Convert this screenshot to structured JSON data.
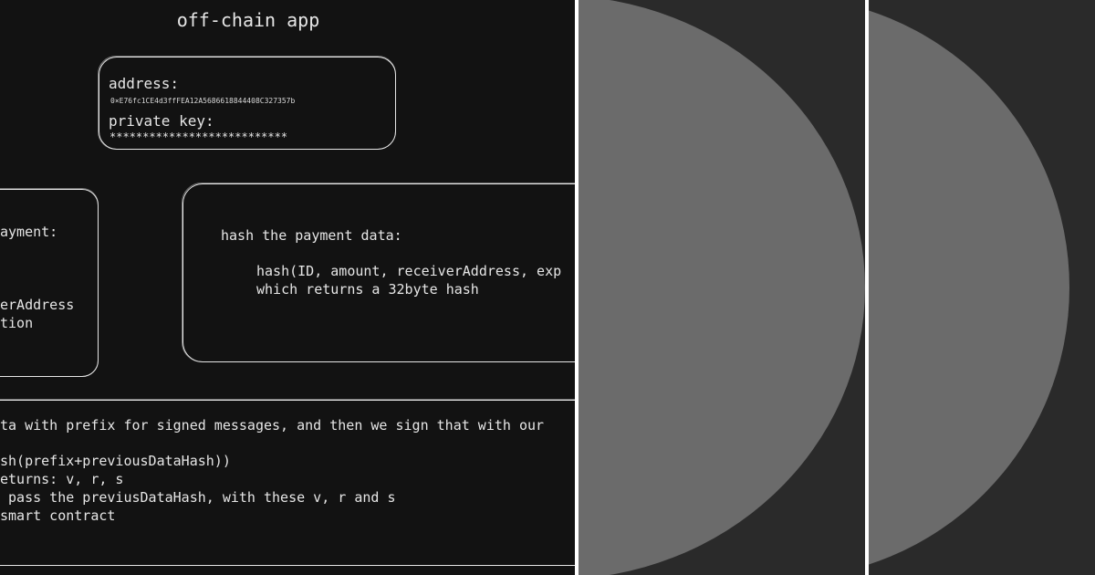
{
  "diagram": {
    "title": "off-chain app",
    "wallet": {
      "address_label": "address:",
      "address_value": "0×E76fc1CE4d3ffFEA12A5686618844408C327357b",
      "private_key_label": "private key:",
      "private_key_value": "***************************"
    },
    "payment": {
      "heading": "ayment:",
      "line1": "erAddress",
      "line2": "tion"
    },
    "hash_box": {
      "heading": "hash the payment data:",
      "line1": "hash(ID, amount, receiverAddress, exp",
      "line2": "which returns a 32byte hash"
    },
    "sign_box": {
      "line1": "ta with prefix for signed messages, and then we sign that with our",
      "line2": "sh(prefix+previousDataHash))",
      "line3": "eturns: v, r, s",
      "line4": " pass the previusDataHash, with these v, r and s",
      "line5": "smart contract"
    }
  },
  "colors": {
    "canvas": "#121212",
    "stroke": "#e6e6e6",
    "panel_bg": "#2a2a2a",
    "disc": "#6b6b6b",
    "divider": "#ffffff"
  }
}
